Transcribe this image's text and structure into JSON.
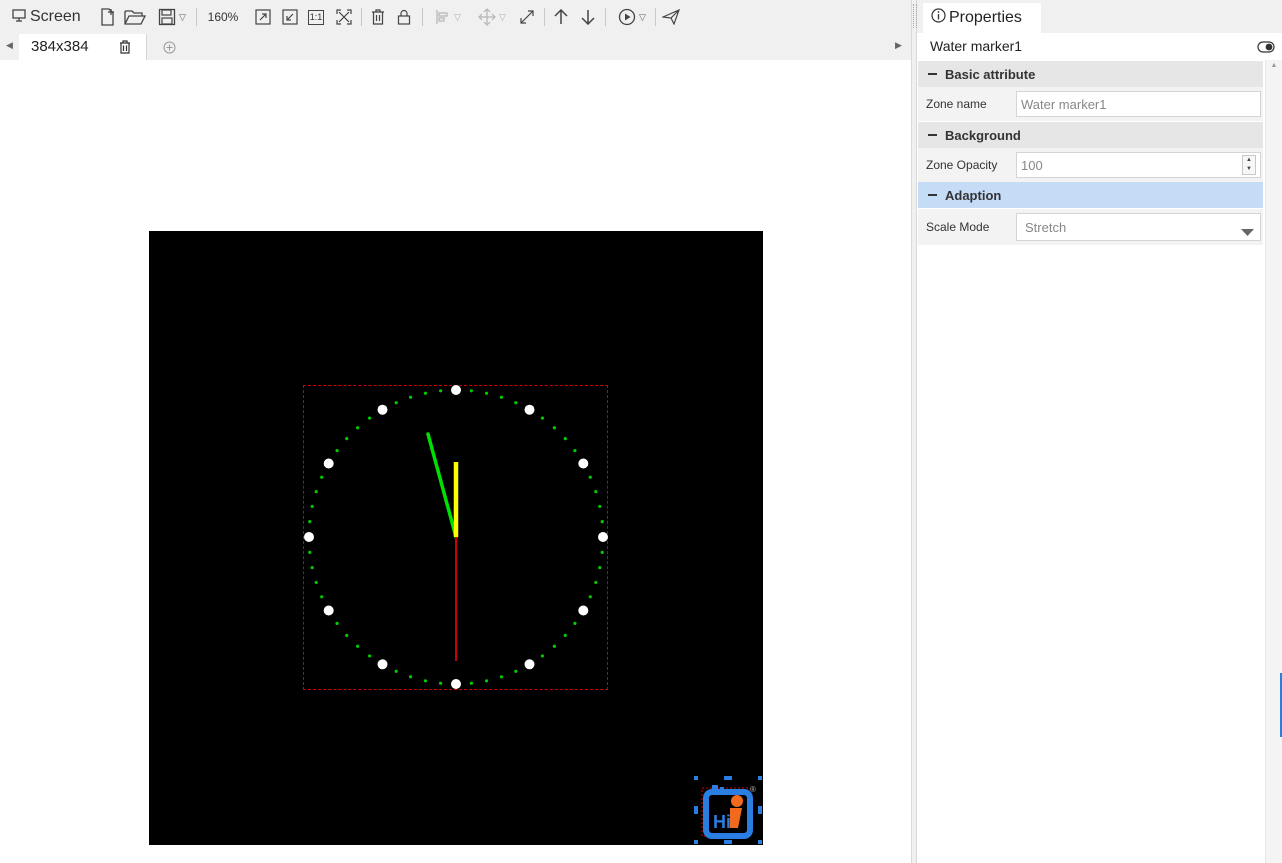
{
  "toolbar": {
    "screen_label": "Screen",
    "zoom": "160%",
    "one_to_one_label": "1:1"
  },
  "tabs": {
    "active_label": "384x384"
  },
  "properties": {
    "tab_label": "Properties",
    "object_name": "Water marker1",
    "sections": {
      "basic": "Basic attribute",
      "background": "Background",
      "adaption": "Adaption"
    },
    "fields": {
      "zone_name_label": "Zone name",
      "zone_name_value": "Water marker1",
      "zone_opacity_label": "Zone Opacity",
      "zone_opacity_value": "100",
      "scale_mode_label": "Scale Mode",
      "scale_mode_value": "Stretch"
    }
  },
  "clock": {
    "hand_colors": {
      "hour": "#ffff00",
      "minute": "#00e000",
      "second": "#cc0000"
    },
    "dot_color": "#00cc00",
    "marker_color": "#ffffff"
  },
  "watermark": {
    "text": "Hi",
    "registered_mark": "®"
  },
  "colors": {
    "accent_blue": "#c5dcf7",
    "watermark_blue": "#2a7de1",
    "watermark_orange": "#f26a1b",
    "selection_red": "#cc0000"
  }
}
